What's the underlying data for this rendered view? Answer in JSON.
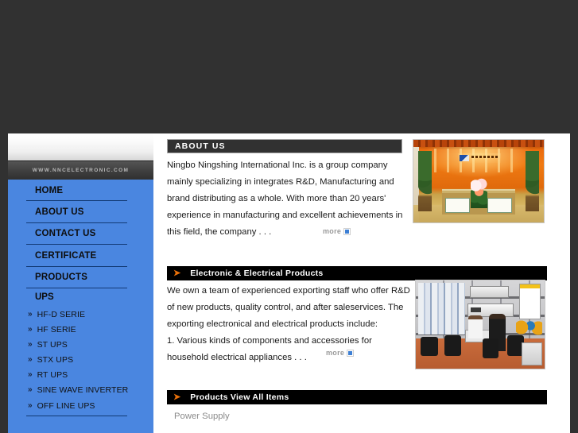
{
  "site": {
    "banner_color": "#313131",
    "sidebar_color": "#4a86e0",
    "accent_orange": "#e8700a",
    "logo_url_text": "WWW.NNCELECTRONIC.COM"
  },
  "sidebar": {
    "main_items": [
      {
        "label": "HOME"
      },
      {
        "label": "ABOUT US"
      },
      {
        "label": "CONTACT US"
      },
      {
        "label": "CERTIFICATE"
      },
      {
        "label": "PRODUCTS"
      }
    ],
    "group": {
      "title": "UPS",
      "bullet": "»",
      "items": [
        {
          "label": "HF-D SERIE"
        },
        {
          "label": "HF SERIE"
        },
        {
          "label": "ST UPS"
        },
        {
          "label": "STX UPS"
        },
        {
          "label": "RT UPS"
        },
        {
          "label": "SINE WAVE INVERTER"
        },
        {
          "label": "OFF LINE UPS"
        }
      ]
    }
  },
  "sections": {
    "about": {
      "title": "ABOUT  US",
      "lines": [
        "Ningbo Ningshing International Inc. is a group company",
        "mainly specializing in integrates R&D, Manufacturing and",
        "brand distributing as a whole. With more than 20 years'",
        "experience in manufacturing and excellent achievements in",
        "this field, the company . . ."
      ],
      "more_label": "more",
      "photo_name": "company-lobby-photo"
    },
    "electronic": {
      "arrow": "➤",
      "title": "Electronic & Electrical Products",
      "lines": [
        "We own a team of experienced exporting staff who offer R&D",
        "of new products, quality control, and after saleservices. The",
        "exporting electronical and electrical products include:",
        "1. Various kinds of components and accessories for",
        "household electrical appliances . . ."
      ],
      "more_label": "more",
      "photo_name": "showroom-photo"
    },
    "products": {
      "arrow": "➤",
      "title": "Products View All Items",
      "items": [
        {
          "label": "Power Supply"
        }
      ]
    }
  }
}
